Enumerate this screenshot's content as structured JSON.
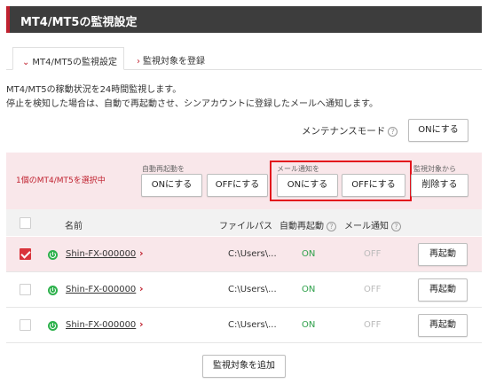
{
  "header": {
    "title": "MT4/MT5の監視設定"
  },
  "tabs": [
    {
      "label": "MT4/MT5の監視設定",
      "chevron": "⌄",
      "active": true
    },
    {
      "label": "監視対象を登録",
      "chevron": "›",
      "active": false
    }
  ],
  "description": {
    "line1": "MT4/MT5の稼動状況を24時間監視します。",
    "line2": "停止を検知した場合は、自動で再起動させ、シンアカウントに登録したメールへ通知します。"
  },
  "maintenance": {
    "label": "メンテナンスモード",
    "help": "?",
    "button": "ONにする"
  },
  "selection_panel": {
    "selected_text": "1個のMT4/MT5を選択中",
    "auto_restart": {
      "label": "自動再起動を",
      "on": "ONにする",
      "off": "OFFにする"
    },
    "mail_notify": {
      "label": "メール通知を",
      "on": "ONにする",
      "off": "OFFにする"
    },
    "remove": {
      "label": "監視対象から",
      "button": "削除する"
    }
  },
  "table": {
    "columns": {
      "name": "名前",
      "path": "ファイルパス",
      "auto_restart": "自動再起動",
      "mail_notify": "メール通知",
      "help": "?"
    },
    "rows": [
      {
        "name": "Shin-FX-000000",
        "path": "C:\\Users\\...",
        "auto_restart": "ON",
        "mail_notify": "OFF",
        "action": "再起動",
        "selected": true
      },
      {
        "name": "Shin-FX-000000",
        "path": "C:\\Users\\...",
        "auto_restart": "ON",
        "mail_notify": "OFF",
        "action": "再起動",
        "selected": false
      },
      {
        "name": "Shin-FX-000000",
        "path": "C:\\Users\\...",
        "auto_restart": "ON",
        "mail_notify": "OFF",
        "action": "再起動",
        "selected": false
      }
    ],
    "row_arrow": "›"
  },
  "footer": {
    "add_button": "監視対象を追加"
  },
  "colors": {
    "accent": "#c0212f",
    "on": "#2ea04a",
    "off": "#bbbbbb",
    "highlight": "#e3141c",
    "selected_bg": "#f9e7ea",
    "header_bg": "#3d3d3d"
  },
  "icons": {
    "power": "power-icon",
    "chevron": "chevron-icon",
    "help": "help-icon",
    "check": "check-icon"
  }
}
